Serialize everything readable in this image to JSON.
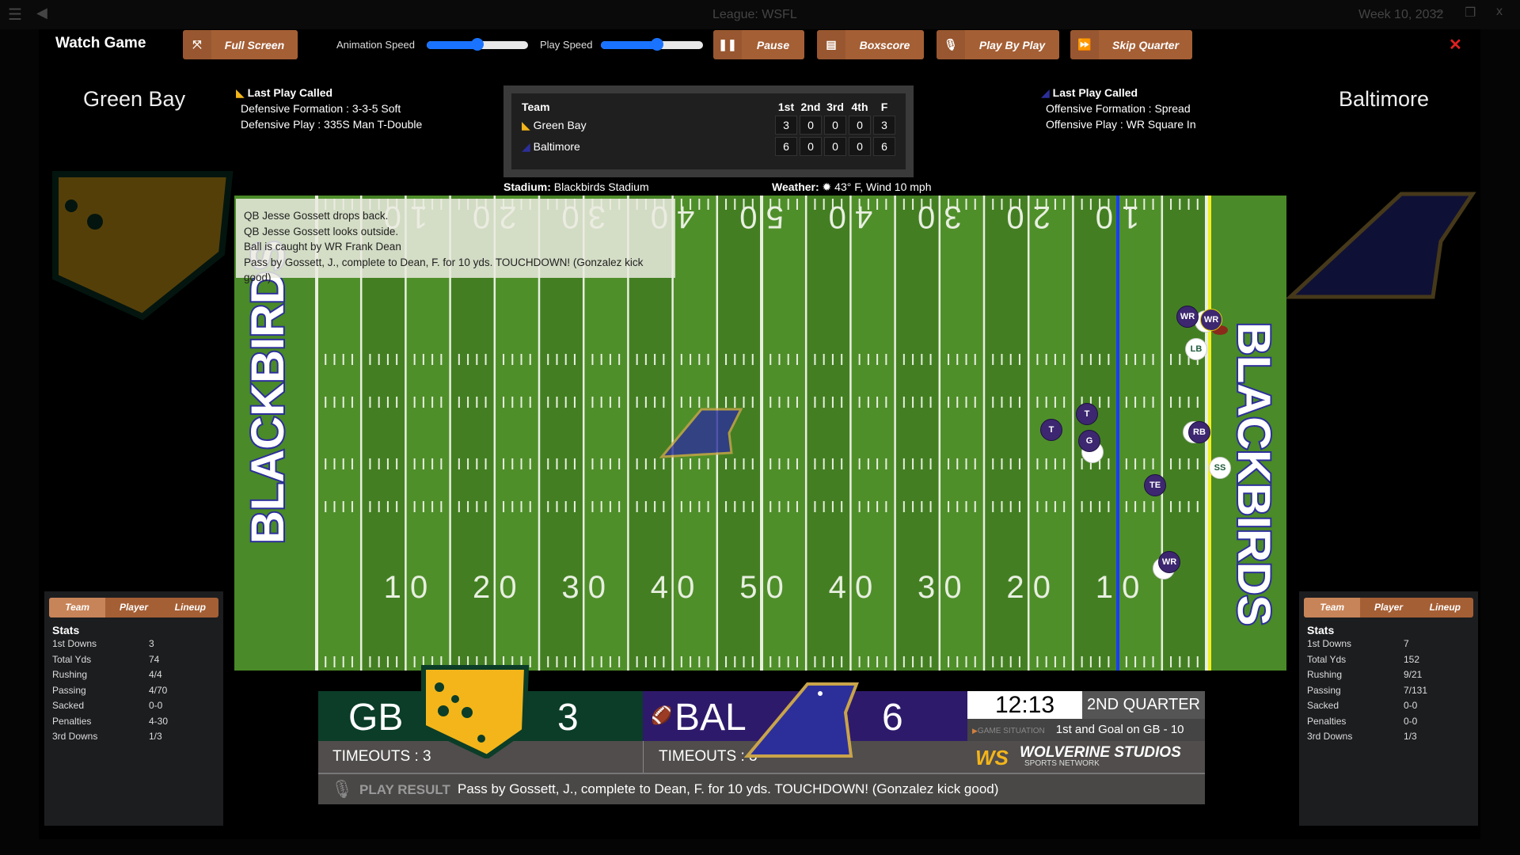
{
  "shell": {
    "league": "League: WSFL",
    "week": "Week 10, 2032"
  },
  "toolbar": {
    "title": "Watch Game",
    "full_screen": "Full Screen",
    "animation_speed": "Animation Speed",
    "animation_speed_value": 0.5,
    "play_speed": "Play Speed",
    "play_speed_value": 0.55,
    "pause": "Pause",
    "boxscore": "Boxscore",
    "play_by_play": "Play By Play",
    "skip_quarter": "Skip Quarter",
    "close": "✕"
  },
  "home": {
    "name": "Green Bay",
    "abbr": "GB",
    "score": "3",
    "timeouts": "TIMEOUTS : 3",
    "color": "#0b3d28",
    "accent": "#f3b51a",
    "last_play": {
      "heading": "Last Play Called",
      "line1": "Defensive Formation : 3-3-5 Soft",
      "line2": "Defensive Play : 335S Man T-Double"
    },
    "tabs": [
      "Team",
      "Player",
      "Lineup"
    ],
    "stats_title": "Stats",
    "stats": [
      [
        "1st Downs",
        "3"
      ],
      [
        "Total Yds",
        "74"
      ],
      [
        "Rushing",
        "4/4"
      ],
      [
        "Passing",
        "4/70"
      ],
      [
        "Sacked",
        "0-0"
      ],
      [
        "Penalties",
        "4-30"
      ],
      [
        "3rd Downs",
        "1/3"
      ]
    ]
  },
  "away": {
    "name": "Baltimore",
    "abbr": "BAL",
    "score": "6",
    "timeouts": "TIMEOUTS : 3",
    "color": "#2e1a6b",
    "accent": "#2c2f9a",
    "last_play": {
      "heading": "Last Play Called",
      "line1": "Offensive Formation : Spread",
      "line2": "Offensive Play : WR Square In"
    },
    "tabs": [
      "Team",
      "Player",
      "Lineup"
    ],
    "stats_title": "Stats",
    "stats": [
      [
        "1st Downs",
        "7"
      ],
      [
        "Total Yds",
        "152"
      ],
      [
        "Rushing",
        "9/21"
      ],
      [
        "Passing",
        "7/131"
      ],
      [
        "Sacked",
        "0-0"
      ],
      [
        "Penalties",
        "0-0"
      ],
      [
        "3rd Downs",
        "1/3"
      ]
    ]
  },
  "boxscore": {
    "headers": [
      "Team",
      "1st",
      "2nd",
      "3rd",
      "4th",
      "F"
    ],
    "rows": [
      {
        "team": "Green Bay",
        "q": [
          "3",
          "0",
          "0",
          "0",
          "3"
        ]
      },
      {
        "team": "Baltimore",
        "q": [
          "6",
          "0",
          "0",
          "0",
          "6"
        ]
      }
    ]
  },
  "venue": {
    "stadium_label": "Stadium:",
    "stadium": "Blackbirds Stadium",
    "weather_label": "Weather:",
    "weather": "43° F, Wind 10 mph"
  },
  "field": {
    "endzone_text": "BLACKBIRDS",
    "yard_numbers": [
      "10",
      "20",
      "30",
      "40",
      "50",
      "40",
      "30",
      "20",
      "10"
    ],
    "line_of_scrimmage_color": "#1a3cff",
    "first_down_color": "#f0f020"
  },
  "play_log": [
    "QB Jesse Gossett drops back.",
    "QB Jesse Gossett looks outside.",
    "Ball is caught by WR Frank Dean",
    "Pass by Gossett, J., complete to Dean, F. for 10 yds. TOUCHDOWN! (Gonzalez kick good)"
  ],
  "players": {
    "offense": [
      "WR",
      "WR",
      "T",
      "T",
      "G",
      "RB",
      "TE",
      "WR"
    ],
    "defense": [
      "LB",
      "SS"
    ]
  },
  "scoreboard": {
    "clock": "12:13",
    "quarter": "2ND QUARTER",
    "situation_label": "GAME SITUATION",
    "situation": "1st and Goal on GB - 10",
    "brand": "WOLVERINE STUDIOS",
    "brand_sub": "SPORTS NETWORK",
    "play_result_label": "PLAY RESULT",
    "play_result": "Pass by Gossett, J., complete to Dean, F. for 10 yds. TOUCHDOWN! (Gonzalez kick good)"
  }
}
